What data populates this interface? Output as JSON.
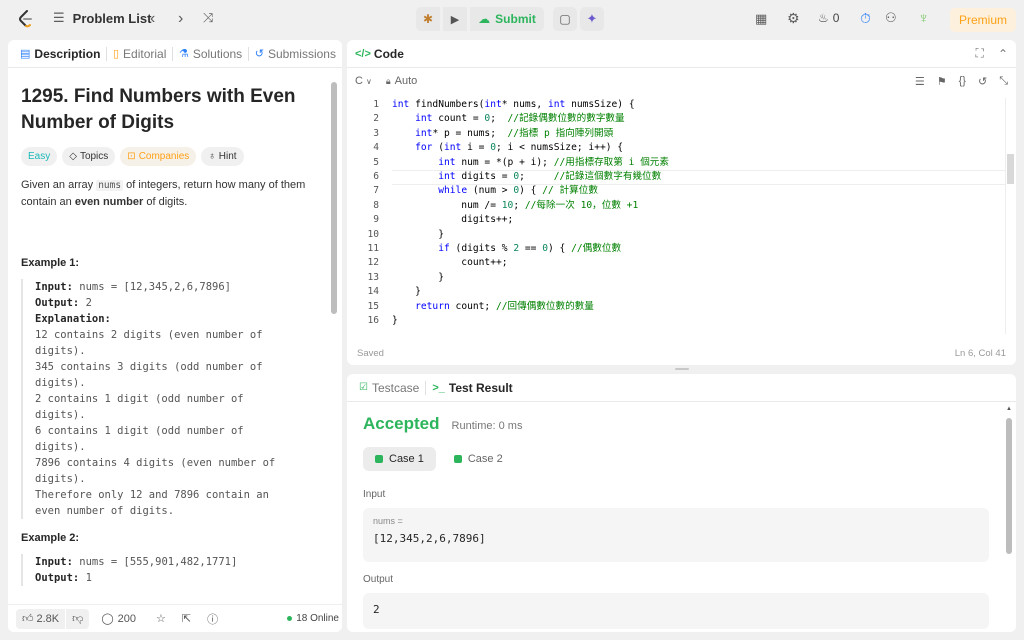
{
  "topbar": {
    "problem_list": "Problem List",
    "submit": "Submit",
    "coins": "0",
    "premium": "Premium"
  },
  "left": {
    "tabs": [
      "Description",
      "Editorial",
      "Solutions",
      "Submissions"
    ],
    "title_line1": "1295. Find Numbers with Even",
    "title_line2": "Number of Digits",
    "pills": {
      "easy": "Easy",
      "topics": "Topics",
      "companies": "Companies",
      "hint": "Hint"
    },
    "desc": {
      "pre": "Given an array ",
      "code": "nums",
      "mid": " of integers, return how many of them",
      "line2_pre": "contain an ",
      "bold": "even number",
      "post": " of digits."
    },
    "example1_title": "Example 1:",
    "example1": {
      "input_label": "Input:",
      "input": " nums = [12,345,2,6,7896]",
      "output_label": "Output:",
      "output": " 2",
      "expl_label": "Explanation:",
      "lines": [
        "12 contains 2 digits (even number of",
        "digits).",
        "345 contains 3 digits (odd number of",
        "digits).",
        "2 contains 1 digit (odd number of",
        "digits).",
        "6 contains 1 digit (odd number of",
        "digits).",
        "7896 contains 4 digits (even number of",
        "digits).",
        "Therefore only 12 and 7896 contain an",
        "even number of digits."
      ]
    },
    "example2_title": "Example 2:",
    "example2": {
      "input_label": "Input:",
      "input": " nums = [555,901,482,1771]",
      "output_label": "Output:",
      "output": " 1"
    },
    "footer": {
      "likes": "2.8K",
      "comments": "200",
      "online": "18 Online"
    }
  },
  "code_panel": {
    "title": "Code",
    "lang": "C",
    "auto": "Auto",
    "saved": "Saved",
    "cursor": "Ln 6, Col 41"
  },
  "result_panel": {
    "tabs": [
      "Testcase",
      "Test Result"
    ],
    "status": "Accepted",
    "runtime": "Runtime: 0 ms",
    "cases": [
      "Case 1",
      "Case 2"
    ],
    "input_label": "Input",
    "var_label": "nums =",
    "input_value": "[12,345,2,6,7896]",
    "output_label": "Output",
    "output_value": "2"
  },
  "colors": {
    "easy": "#1cb8b8",
    "accepted": "#2db55d",
    "premium_bg": "#fdf0dc",
    "premium_fg": "#ffa116",
    "submit": "#2db55d"
  }
}
